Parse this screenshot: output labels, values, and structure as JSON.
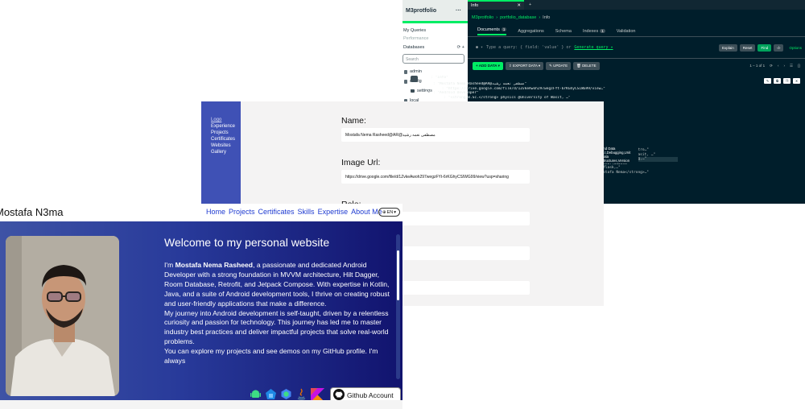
{
  "compass": {
    "brand": "M3protfolio",
    "brand_menu": "···",
    "nav": [
      "My Queries",
      "Performance"
    ],
    "databases_label": "Databases",
    "search_placeholder": "Search",
    "tree": [
      {
        "label": "admin",
        "level": 0
      },
      {
        "label": "config",
        "level": 0
      },
      {
        "label": "settings",
        "level": 1
      },
      {
        "label": "local",
        "level": 0
      }
    ],
    "tab_title": "Info",
    "tab_close": "✕",
    "tab_add": "+",
    "breadcrumb": [
      "M3protfolio",
      "portfolio_database",
      "Info"
    ],
    "subtabs": [
      {
        "label": "Documents",
        "count": "1"
      },
      {
        "label": "Aggregations",
        "count": ""
      },
      {
        "label": "Schema",
        "count": ""
      },
      {
        "label": "Indexes",
        "count": "1"
      },
      {
        "label": "Validation",
        "count": ""
      }
    ],
    "query_placeholder": "Type a query: { field: 'value' } or",
    "generate_query": "Generate query ✦",
    "query_buttons": {
      "explain": "Explain",
      "reset": "Reset",
      "find": "Find",
      "options": "Options"
    },
    "toolbar": {
      "add": "ADD DATA",
      "export": "EXPORT DATA",
      "update": "UPDATE",
      "delete": "DELETE"
    },
    "pager": "1 – 1 of 1",
    "doc_rows": [
      {
        "key": "_id",
        "val": ": \"Info\""
      },
      {
        "key": "name",
        "val": ": \"Mostafa Nema Rasheed@AR@مصطفى نعمه رشيد\""
      },
      {
        "key": "imageUrl",
        "val": ": \"https://drive.google.com/file/d/1ZvkeAwoh297wegzFYt-6rKGhyCSIWG99/view…\""
      },
      {
        "key": "role",
        "val": ": \"Android Developer\""
      },
      {
        "key": "education",
        "val": ": \"<strong>B.Sc.</strong> physics @University of Wasit, …\""
      }
    ],
    "extra_rows": [
      "<strong>!<br/><br/> I'm <stro…\"",
      "… physics @University of Wasit, …\"",
      "… Version Control,Debugging,…\"",
      "…<br/>\\u003cbr\\u003e…\"",
      "…retrofit,flask,…\"",
      "",
      "…strong>Mostafa Nema</strong>…\""
    ],
    "tooltip": [
      "and Data",
      "…t,Debugging,Unit",
      "Data Structures,Version"
    ],
    "doc_action_icons": [
      "pencil-icon",
      "copy-icon",
      "clone-icon",
      "trash-icon"
    ]
  },
  "admin": {
    "sidebar": [
      "Logo",
      "Experience",
      "Projects",
      "Certificates",
      "Websites",
      "Gallery"
    ],
    "fields": [
      {
        "label": "Name:",
        "value": "Mostafa Nema Rasheed@AR@مصطفى نعمه رشيد"
      },
      {
        "label": "Image Url:",
        "value": "https://drive.google.com/file/d/1ZvkeAwoh297wegzFYt-6rKGhyCSIWG99/view?usp=sharing"
      },
      {
        "label": "Role:",
        "value": ""
      }
    ]
  },
  "portfolio": {
    "brand": "Mostafa N3ma",
    "nav": [
      "Home",
      "Projects",
      "Certificates",
      "Skills",
      "Expertise",
      "About Me"
    ],
    "lang": "EN",
    "hero_title": "Welcome to my personal website",
    "bio_intro": "I'm ",
    "bio_name": "Mostafa Nema Rasheed",
    "bio_rest": ", a passionate and dedicated Android Developer with a strong foundation in MVVM architecture, Hilt Dagger, Room Database, Retrofit, and Jetpack Compose. With expertise in Kotlin, Java, and a suite of Android development tools, I thrive on creating robust and user-friendly applications that make a difference.",
    "bio_p2": "My journey into Android development is self-taught, driven by a relentless curiosity and passion for technology. This journey has led me to master industry best practices and deliver impactful projects that solve real-world problems.",
    "bio_p3": "You can explore my projects and see demos on my GitHub profile. I'm always",
    "tech_icons": [
      "android-icon",
      "kotlin-multiplatform-icon",
      "jetpack-compose-icon",
      "java-icon",
      "kotlin-icon"
    ],
    "github_button": "Github Account"
  }
}
